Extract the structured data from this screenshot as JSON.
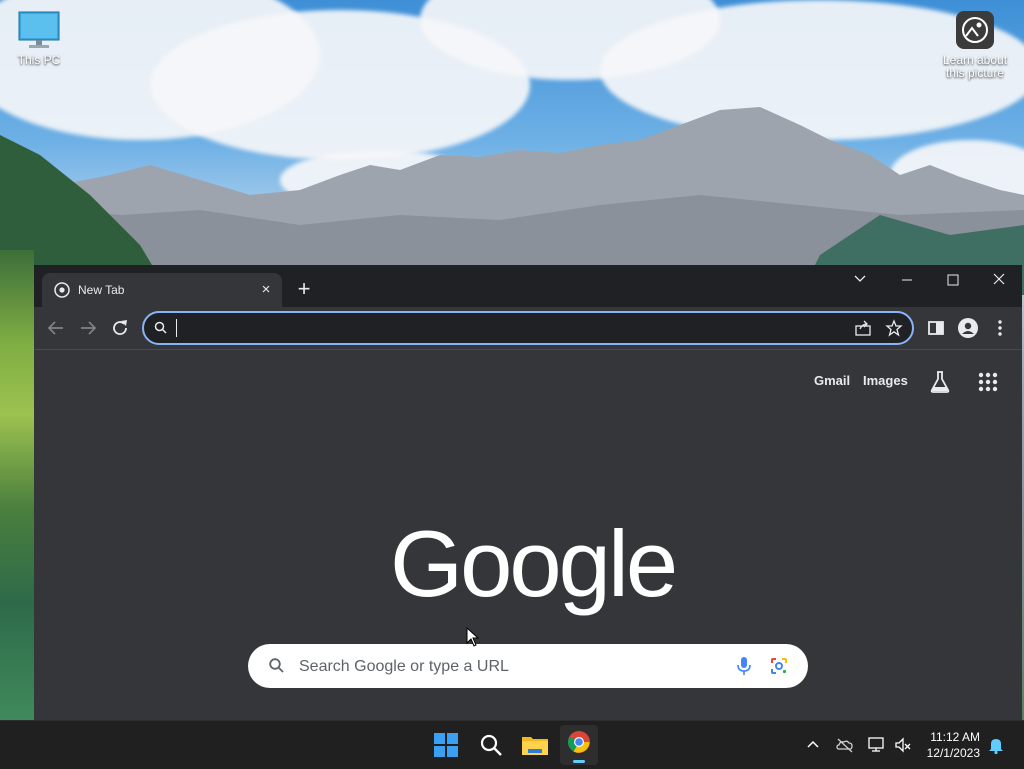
{
  "desktop": {
    "icons": [
      {
        "label": "This PC"
      },
      {
        "label": "Learn about this picture"
      }
    ]
  },
  "browser": {
    "tab": {
      "title": "New Tab",
      "close_label": "×"
    },
    "new_tab_label": "+",
    "omnibox": {
      "value": ""
    },
    "header_links": {
      "gmail": "Gmail",
      "images": "Images"
    },
    "logo_text": "Google",
    "search": {
      "placeholder": "Search Google or type a URL"
    }
  },
  "taskbar": {
    "time": "11:12 AM",
    "date": "12/1/2023"
  },
  "colors": {
    "window_bg": "#35363a",
    "titlebar_bg": "#202124",
    "omnibox_focus": "#8ab4f8",
    "taskbar_bg": "#202020"
  }
}
